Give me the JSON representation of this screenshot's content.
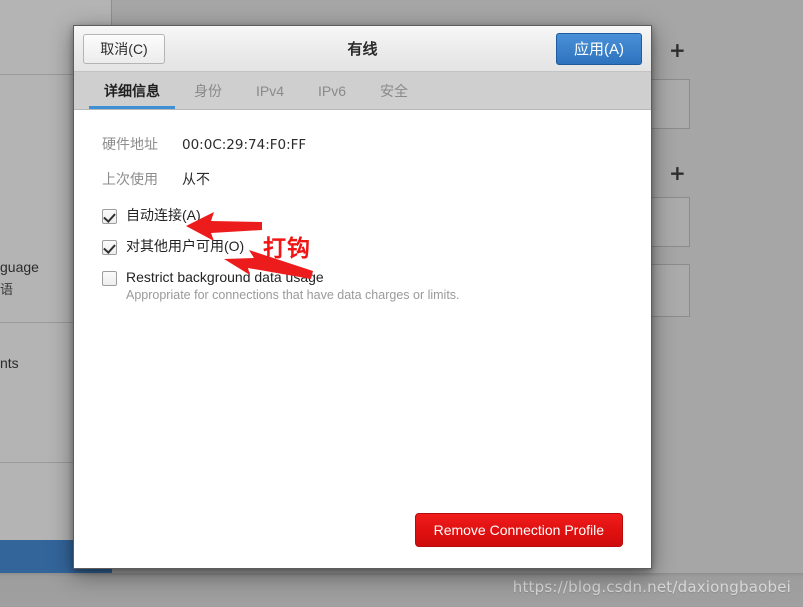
{
  "background": {
    "left_items": [
      {
        "label": "guage",
        "note": "partially visible Language row"
      },
      {
        "label": "语",
        "note": "partially visible cjk"
      },
      {
        "label": "nts",
        "note": "partially visible row"
      }
    ],
    "add_button_label": "+",
    "gear_icon": "gear-icon",
    "watermark": "https://blog.csdn.net/daxiongbaobei"
  },
  "dialog": {
    "title": "有线",
    "cancel_label": "取消(C)",
    "apply_label": "应用(A)",
    "tabs": [
      {
        "label": "详细信息",
        "active": true
      },
      {
        "label": "身份",
        "active": false
      },
      {
        "label": "IPv4",
        "active": false
      },
      {
        "label": "IPv6",
        "active": false
      },
      {
        "label": "安全",
        "active": false
      }
    ],
    "details": [
      {
        "label": "硬件地址",
        "value": "00:0C:29:74:F0:FF"
      },
      {
        "label": "上次使用",
        "value": "从不"
      }
    ],
    "checkboxes": [
      {
        "label": "自动连接(A)",
        "sub": "",
        "checked": true
      },
      {
        "label": "对其他用户可用(O)",
        "sub": "",
        "checked": true
      },
      {
        "label": "Restrict background data usage",
        "sub": "Appropriate for connections that have data charges or limits.",
        "checked": false
      }
    ],
    "remove_label": "Remove Connection Profile"
  },
  "annotations": {
    "text": "打钩",
    "color": "#f01414"
  },
  "colors": {
    "accent_blue": "#3f8fd4",
    "apply_blue": "#2e73bd",
    "danger_red": "#e01010",
    "annotation_red": "#f01414",
    "selected_row_blue": "#33659b"
  }
}
